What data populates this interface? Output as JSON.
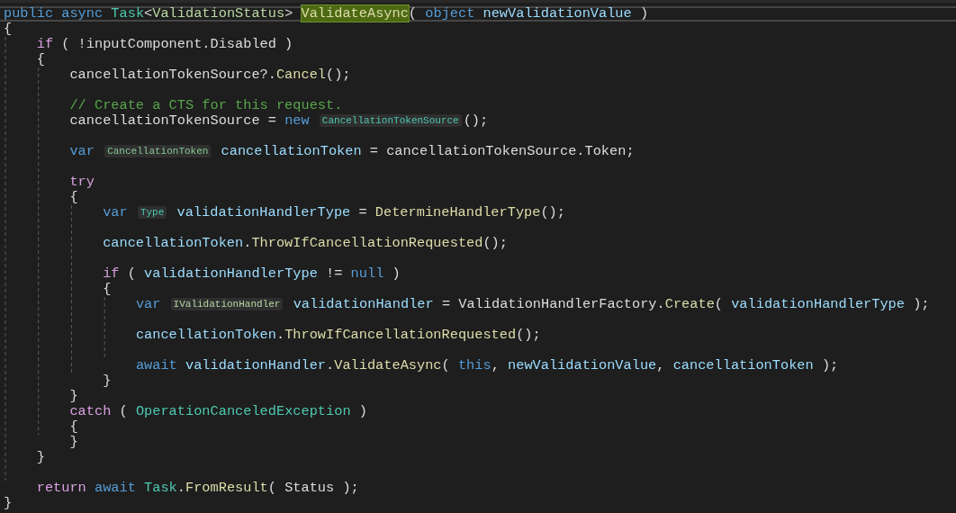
{
  "editor": {
    "lines": [
      {
        "kind": "code",
        "current": true,
        "tokens": [
          {
            "text": "public ",
            "kind": "kw"
          },
          {
            "text": "async ",
            "kind": "kw"
          },
          {
            "text": "Task",
            "kind": "type"
          },
          {
            "text": "<",
            "kind": "plain"
          },
          {
            "text": "ValidationStatus",
            "kind": "iface"
          },
          {
            "text": "> ",
            "kind": "plain"
          },
          {
            "text": "ValidateAsync",
            "kind": "highlight"
          },
          {
            "text": "( ",
            "kind": "plain"
          },
          {
            "text": "object ",
            "kind": "kw"
          },
          {
            "text": "newValidationValue ",
            "kind": "local"
          },
          {
            "text": ")",
            "kind": "plain"
          }
        ]
      },
      {
        "kind": "code",
        "tokens": [
          {
            "text": "{",
            "kind": "plain"
          }
        ]
      },
      {
        "kind": "code",
        "tokens": [
          {
            "text": "    if",
            "kind": "ctl"
          },
          {
            "text": " ( !inputComponent.Disabled )",
            "kind": "plain"
          }
        ]
      },
      {
        "kind": "code",
        "tokens": [
          {
            "text": "    {",
            "kind": "plain"
          }
        ]
      },
      {
        "kind": "code",
        "tokens": [
          {
            "text": "        cancellationTokenSource?.",
            "kind": "plain"
          },
          {
            "text": "Cancel",
            "kind": "method"
          },
          {
            "text": "();",
            "kind": "plain"
          }
        ]
      },
      {
        "kind": "blank"
      },
      {
        "kind": "code",
        "tokens": [
          {
            "text": "        // Create a CTS for this request.",
            "kind": "comment"
          }
        ]
      },
      {
        "kind": "code",
        "tokens": [
          {
            "text": "        cancellationTokenSource = ",
            "kind": "plain"
          },
          {
            "text": "new ",
            "kind": "kw"
          },
          {
            "text": "CancellationTokenSource",
            "kind": "hint_class"
          },
          {
            "text": "();",
            "kind": "plain"
          }
        ]
      },
      {
        "kind": "blank"
      },
      {
        "kind": "code",
        "tokens": [
          {
            "text": "        var ",
            "kind": "kw"
          },
          {
            "text": "CancellationToken",
            "kind": "hint_struct"
          },
          {
            "text": " cancellationToken",
            "kind": "local"
          },
          {
            "text": " = cancellationTokenSource.Token;",
            "kind": "plain"
          }
        ]
      },
      {
        "kind": "blank"
      },
      {
        "kind": "code",
        "tokens": [
          {
            "text": "        try",
            "kind": "ctl"
          }
        ]
      },
      {
        "kind": "code",
        "tokens": [
          {
            "text": "        {",
            "kind": "plain"
          }
        ]
      },
      {
        "kind": "code",
        "tokens": [
          {
            "text": "            var ",
            "kind": "kw"
          },
          {
            "text": "Type",
            "kind": "hint_class"
          },
          {
            "text": " validationHandlerType",
            "kind": "local"
          },
          {
            "text": " = ",
            "kind": "plain"
          },
          {
            "text": "DetermineHandlerType",
            "kind": "method"
          },
          {
            "text": "();",
            "kind": "plain"
          }
        ]
      },
      {
        "kind": "blank"
      },
      {
        "kind": "code",
        "tokens": [
          {
            "text": "            cancellationToken",
            "kind": "local"
          },
          {
            "text": ".",
            "kind": "plain"
          },
          {
            "text": "ThrowIfCancellationRequested",
            "kind": "method"
          },
          {
            "text": "();",
            "kind": "plain"
          }
        ]
      },
      {
        "kind": "blank"
      },
      {
        "kind": "code",
        "tokens": [
          {
            "text": "            if",
            "kind": "ctl"
          },
          {
            "text": " ( ",
            "kind": "plain"
          },
          {
            "text": "validationHandlerType",
            "kind": "local"
          },
          {
            "text": " != ",
            "kind": "plain"
          },
          {
            "text": "null",
            "kind": "kw"
          },
          {
            "text": " )",
            "kind": "plain"
          }
        ]
      },
      {
        "kind": "code",
        "tokens": [
          {
            "text": "            {",
            "kind": "plain"
          }
        ]
      },
      {
        "kind": "code",
        "tokens": [
          {
            "text": "                var ",
            "kind": "kw"
          },
          {
            "text": "IValidationHandler",
            "kind": "hint_interface"
          },
          {
            "text": " validationHandler",
            "kind": "local"
          },
          {
            "text": " = ValidationHandlerFactory.",
            "kind": "plain"
          },
          {
            "text": "Create",
            "kind": "method"
          },
          {
            "text": "( ",
            "kind": "plain"
          },
          {
            "text": "validationHandlerType",
            "kind": "local"
          },
          {
            "text": " );",
            "kind": "plain"
          }
        ]
      },
      {
        "kind": "blank"
      },
      {
        "kind": "code",
        "tokens": [
          {
            "text": "                cancellationToken",
            "kind": "local"
          },
          {
            "text": ".",
            "kind": "plain"
          },
          {
            "text": "ThrowIfCancellationRequested",
            "kind": "method"
          },
          {
            "text": "();",
            "kind": "plain"
          }
        ]
      },
      {
        "kind": "blank"
      },
      {
        "kind": "code",
        "tokens": [
          {
            "text": "                await ",
            "kind": "kw"
          },
          {
            "text": "validationHandler",
            "kind": "local"
          },
          {
            "text": ".",
            "kind": "plain"
          },
          {
            "text": "ValidateAsync",
            "kind": "method"
          },
          {
            "text": "( ",
            "kind": "plain"
          },
          {
            "text": "this",
            "kind": "kw"
          },
          {
            "text": ", ",
            "kind": "plain"
          },
          {
            "text": "newValidationValue",
            "kind": "local"
          },
          {
            "text": ", ",
            "kind": "plain"
          },
          {
            "text": "cancellationToken",
            "kind": "local"
          },
          {
            "text": " );",
            "kind": "plain"
          }
        ]
      },
      {
        "kind": "code",
        "tokens": [
          {
            "text": "            }",
            "kind": "plain"
          }
        ]
      },
      {
        "kind": "code",
        "tokens": [
          {
            "text": "        }",
            "kind": "plain"
          }
        ]
      },
      {
        "kind": "code",
        "tokens": [
          {
            "text": "        catch",
            "kind": "ctl"
          },
          {
            "text": " ( ",
            "kind": "plain"
          },
          {
            "text": "OperationCanceledException",
            "kind": "type"
          },
          {
            "text": " )",
            "kind": "plain"
          }
        ]
      },
      {
        "kind": "code",
        "tokens": [
          {
            "text": "        {",
            "kind": "plain"
          }
        ]
      },
      {
        "kind": "code",
        "tokens": [
          {
            "text": "        }",
            "kind": "plain"
          }
        ]
      },
      {
        "kind": "code",
        "tokens": [
          {
            "text": "    }",
            "kind": "plain"
          }
        ]
      },
      {
        "kind": "blank"
      },
      {
        "kind": "code",
        "tokens": [
          {
            "text": "    return ",
            "kind": "ctl"
          },
          {
            "text": "await ",
            "kind": "kw"
          },
          {
            "text": "Task",
            "kind": "type"
          },
          {
            "text": ".",
            "kind": "plain"
          },
          {
            "text": "FromResult",
            "kind": "method"
          },
          {
            "text": "( Status );",
            "kind": "plain"
          }
        ]
      },
      {
        "kind": "code",
        "tokens": [
          {
            "text": "}",
            "kind": "plain"
          }
        ]
      }
    ]
  }
}
